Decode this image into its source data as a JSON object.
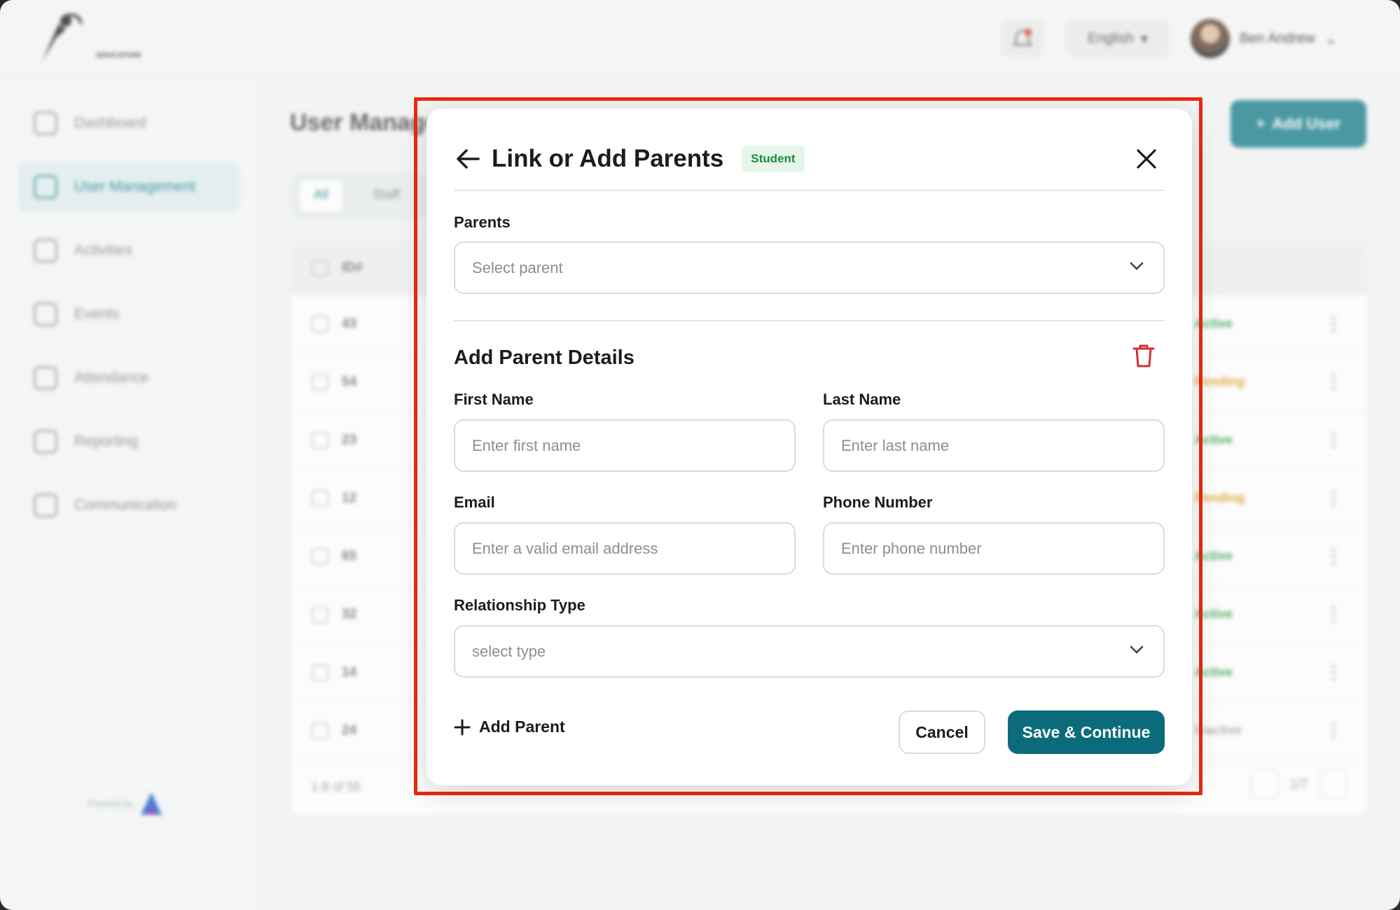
{
  "app": {
    "logo_text": "EDUCATION",
    "language": "English",
    "user_name": "Ben Andrew",
    "powered_by": "Powered by"
  },
  "sidebar": {
    "items": [
      {
        "label": "Dashboard",
        "icon": "dashboard-icon"
      },
      {
        "label": "User Management",
        "icon": "users-icon",
        "active": true
      },
      {
        "label": "Activities",
        "icon": "activities-icon"
      },
      {
        "label": "Events",
        "icon": "events-icon"
      },
      {
        "label": "Attendance",
        "icon": "attendance-icon"
      },
      {
        "label": "Reporting",
        "icon": "reporting-icon"
      },
      {
        "label": "Communication",
        "icon": "communication-icon"
      }
    ]
  },
  "main": {
    "title": "User Manage",
    "add_user_label": "Add User",
    "tabs": [
      "All",
      "Staff"
    ],
    "table": {
      "id_header": "ID#",
      "rows": [
        {
          "id": "43",
          "status": "Active"
        },
        {
          "id": "54",
          "status": "Pending"
        },
        {
          "id": "23",
          "status": "Active"
        },
        {
          "id": "12",
          "status": "Pending"
        },
        {
          "id": "65",
          "status": "Active"
        },
        {
          "id": "32",
          "status": "Active"
        },
        {
          "id": "14",
          "status": "Active"
        },
        {
          "id": "24",
          "status": "Inactive"
        }
      ],
      "footer_range": "1-8 of 55",
      "page": "1/7"
    }
  },
  "modal": {
    "title": "Link or Add Parents",
    "badge": "Student",
    "parents_label": "Parents",
    "parents_placeholder": "Select parent",
    "section_title": "Add Parent Details",
    "first_name_label": "First Name",
    "first_name_placeholder": "Enter first name",
    "last_name_label": "Last Name",
    "last_name_placeholder": "Enter last name",
    "email_label": "Email",
    "email_placeholder": "Enter a valid email address",
    "phone_label": "Phone Number",
    "phone_placeholder": "Enter phone number",
    "relationship_label": "Relationship Type",
    "relationship_placeholder": "select type",
    "add_parent_label": "Add Parent",
    "cancel_label": "Cancel",
    "save_label": "Save & Continue"
  },
  "colors": {
    "primary": "#0c6b7b",
    "badge_bg": "#e7f6ea",
    "badge_text": "#1f8a3a",
    "delete": "#d32f2f",
    "highlight": "#ea2a10"
  }
}
